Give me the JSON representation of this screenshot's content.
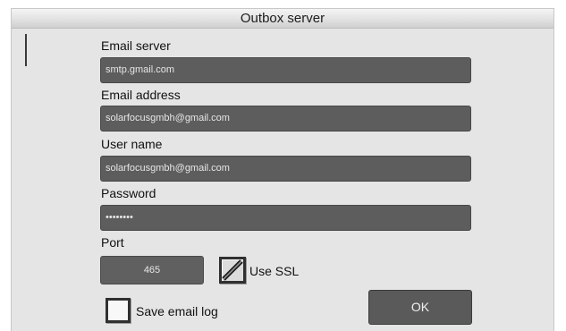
{
  "dialog": {
    "title": "Outbox server"
  },
  "fields": {
    "email_server": {
      "label": "Email server",
      "value": "smtp.gmail.com"
    },
    "email_address": {
      "label": "Email address",
      "value": "solarfocusgmbh@gmail.com"
    },
    "user_name": {
      "label": "User name",
      "value": "solarfocusgmbh@gmail.com"
    },
    "password": {
      "label": "Password",
      "value": "••••••••"
    },
    "port": {
      "label": "Port",
      "value": "465"
    }
  },
  "options": {
    "use_ssl": {
      "label": "Use SSL",
      "checked": true
    },
    "save_email_log": {
      "label": "Save email log",
      "checked": false
    }
  },
  "actions": {
    "ok_label": "OK"
  },
  "colors": {
    "dialog_background": "#e5e5e5",
    "input_background": "#5d5d5d",
    "input_text": "#e6e6e6",
    "label_text": "#111111"
  }
}
